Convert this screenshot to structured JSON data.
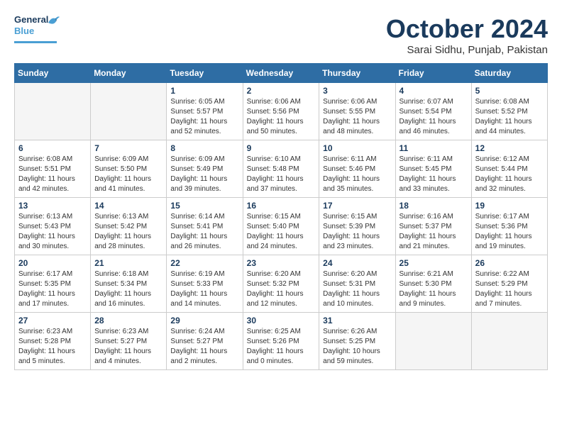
{
  "header": {
    "logo_general": "General",
    "logo_blue": "Blue",
    "month_title": "October 2024",
    "location": "Sarai Sidhu, Punjab, Pakistan"
  },
  "weekdays": [
    "Sunday",
    "Monday",
    "Tuesday",
    "Wednesday",
    "Thursday",
    "Friday",
    "Saturday"
  ],
  "weeks": [
    [
      {
        "day": "",
        "info": ""
      },
      {
        "day": "",
        "info": ""
      },
      {
        "day": "1",
        "info": "Sunrise: 6:05 AM\nSunset: 5:57 PM\nDaylight: 11 hours and 52 minutes."
      },
      {
        "day": "2",
        "info": "Sunrise: 6:06 AM\nSunset: 5:56 PM\nDaylight: 11 hours and 50 minutes."
      },
      {
        "day": "3",
        "info": "Sunrise: 6:06 AM\nSunset: 5:55 PM\nDaylight: 11 hours and 48 minutes."
      },
      {
        "day": "4",
        "info": "Sunrise: 6:07 AM\nSunset: 5:54 PM\nDaylight: 11 hours and 46 minutes."
      },
      {
        "day": "5",
        "info": "Sunrise: 6:08 AM\nSunset: 5:52 PM\nDaylight: 11 hours and 44 minutes."
      }
    ],
    [
      {
        "day": "6",
        "info": "Sunrise: 6:08 AM\nSunset: 5:51 PM\nDaylight: 11 hours and 42 minutes."
      },
      {
        "day": "7",
        "info": "Sunrise: 6:09 AM\nSunset: 5:50 PM\nDaylight: 11 hours and 41 minutes."
      },
      {
        "day": "8",
        "info": "Sunrise: 6:09 AM\nSunset: 5:49 PM\nDaylight: 11 hours and 39 minutes."
      },
      {
        "day": "9",
        "info": "Sunrise: 6:10 AM\nSunset: 5:48 PM\nDaylight: 11 hours and 37 minutes."
      },
      {
        "day": "10",
        "info": "Sunrise: 6:11 AM\nSunset: 5:46 PM\nDaylight: 11 hours and 35 minutes."
      },
      {
        "day": "11",
        "info": "Sunrise: 6:11 AM\nSunset: 5:45 PM\nDaylight: 11 hours and 33 minutes."
      },
      {
        "day": "12",
        "info": "Sunrise: 6:12 AM\nSunset: 5:44 PM\nDaylight: 11 hours and 32 minutes."
      }
    ],
    [
      {
        "day": "13",
        "info": "Sunrise: 6:13 AM\nSunset: 5:43 PM\nDaylight: 11 hours and 30 minutes."
      },
      {
        "day": "14",
        "info": "Sunrise: 6:13 AM\nSunset: 5:42 PM\nDaylight: 11 hours and 28 minutes."
      },
      {
        "day": "15",
        "info": "Sunrise: 6:14 AM\nSunset: 5:41 PM\nDaylight: 11 hours and 26 minutes."
      },
      {
        "day": "16",
        "info": "Sunrise: 6:15 AM\nSunset: 5:40 PM\nDaylight: 11 hours and 24 minutes."
      },
      {
        "day": "17",
        "info": "Sunrise: 6:15 AM\nSunset: 5:39 PM\nDaylight: 11 hours and 23 minutes."
      },
      {
        "day": "18",
        "info": "Sunrise: 6:16 AM\nSunset: 5:37 PM\nDaylight: 11 hours and 21 minutes."
      },
      {
        "day": "19",
        "info": "Sunrise: 6:17 AM\nSunset: 5:36 PM\nDaylight: 11 hours and 19 minutes."
      }
    ],
    [
      {
        "day": "20",
        "info": "Sunrise: 6:17 AM\nSunset: 5:35 PM\nDaylight: 11 hours and 17 minutes."
      },
      {
        "day": "21",
        "info": "Sunrise: 6:18 AM\nSunset: 5:34 PM\nDaylight: 11 hours and 16 minutes."
      },
      {
        "day": "22",
        "info": "Sunrise: 6:19 AM\nSunset: 5:33 PM\nDaylight: 11 hours and 14 minutes."
      },
      {
        "day": "23",
        "info": "Sunrise: 6:20 AM\nSunset: 5:32 PM\nDaylight: 11 hours and 12 minutes."
      },
      {
        "day": "24",
        "info": "Sunrise: 6:20 AM\nSunset: 5:31 PM\nDaylight: 11 hours and 10 minutes."
      },
      {
        "day": "25",
        "info": "Sunrise: 6:21 AM\nSunset: 5:30 PM\nDaylight: 11 hours and 9 minutes."
      },
      {
        "day": "26",
        "info": "Sunrise: 6:22 AM\nSunset: 5:29 PM\nDaylight: 11 hours and 7 minutes."
      }
    ],
    [
      {
        "day": "27",
        "info": "Sunrise: 6:23 AM\nSunset: 5:28 PM\nDaylight: 11 hours and 5 minutes."
      },
      {
        "day": "28",
        "info": "Sunrise: 6:23 AM\nSunset: 5:27 PM\nDaylight: 11 hours and 4 minutes."
      },
      {
        "day": "29",
        "info": "Sunrise: 6:24 AM\nSunset: 5:27 PM\nDaylight: 11 hours and 2 minutes."
      },
      {
        "day": "30",
        "info": "Sunrise: 6:25 AM\nSunset: 5:26 PM\nDaylight: 11 hours and 0 minutes."
      },
      {
        "day": "31",
        "info": "Sunrise: 6:26 AM\nSunset: 5:25 PM\nDaylight: 10 hours and 59 minutes."
      },
      {
        "day": "",
        "info": ""
      },
      {
        "day": "",
        "info": ""
      }
    ]
  ]
}
